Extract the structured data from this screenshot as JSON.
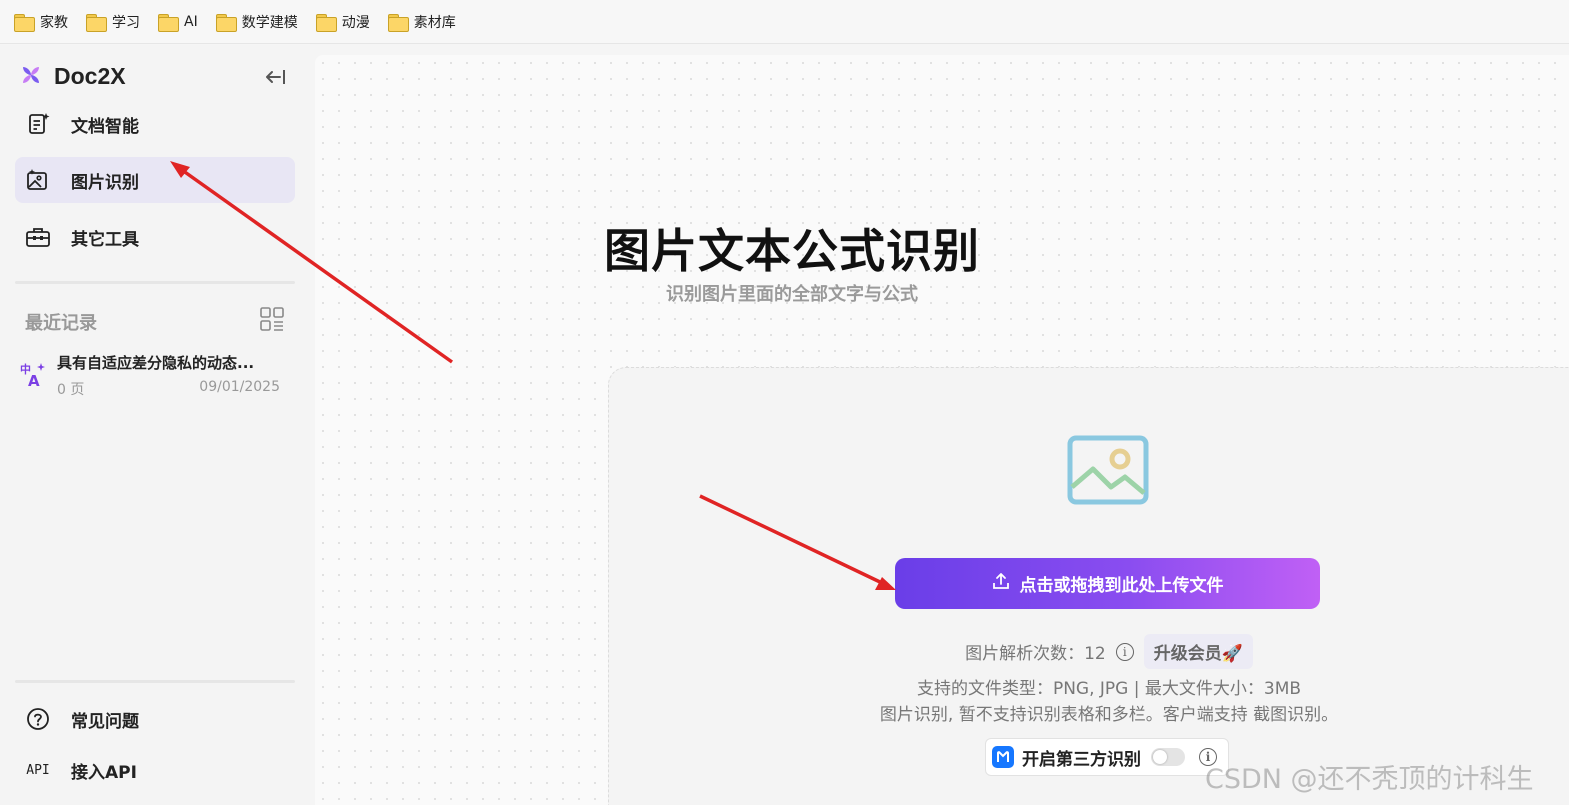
{
  "bookmarks": [
    {
      "label": "家教"
    },
    {
      "label": "学习"
    },
    {
      "label": "AI"
    },
    {
      "label": "数学建模"
    },
    {
      "label": "动漫"
    },
    {
      "label": "素材库"
    }
  ],
  "sidebar": {
    "brand": "Doc2X",
    "nav": [
      {
        "label": "文档智能",
        "icon": "document-ai-icon"
      },
      {
        "label": "图片识别",
        "icon": "image-ai-icon",
        "active": true
      },
      {
        "label": "其它工具",
        "icon": "toolbox-icon"
      }
    ],
    "recent": {
      "title": "最近记录",
      "items": [
        {
          "name": "具有自适应差分隐私的动态...",
          "pages": "0 页",
          "date": "09/01/2025"
        }
      ]
    },
    "footer": [
      {
        "label": "常见问题",
        "icon": "help-icon"
      },
      {
        "label": "接入API",
        "icon": "api-icon",
        "icon_text": "API"
      }
    ]
  },
  "main": {
    "title": "图片文本公式识别",
    "subtitle": "识别图片里面的全部文字与公式",
    "upload_label": "点击或拖拽到此处上传文件",
    "quota_label": "图片解析次数：12",
    "upgrade_label": "升级会员🚀",
    "support_line1": "支持的文件类型：PNG, JPG  |  最大文件大小：3MB",
    "support_line2": "图片识别, 暂不支持识别表格和多栏。客户端支持 截图识别。",
    "third_party_label": "开启第三方识别",
    "third_party_enabled": false
  },
  "watermark": "CSDN @还不秃顶的计科生",
  "colors": {
    "accent_start": "#6a3ee8",
    "accent_end": "#c060f5",
    "active_nav_bg": "#e8e6f4",
    "annotation_arrow": "#e02424"
  }
}
